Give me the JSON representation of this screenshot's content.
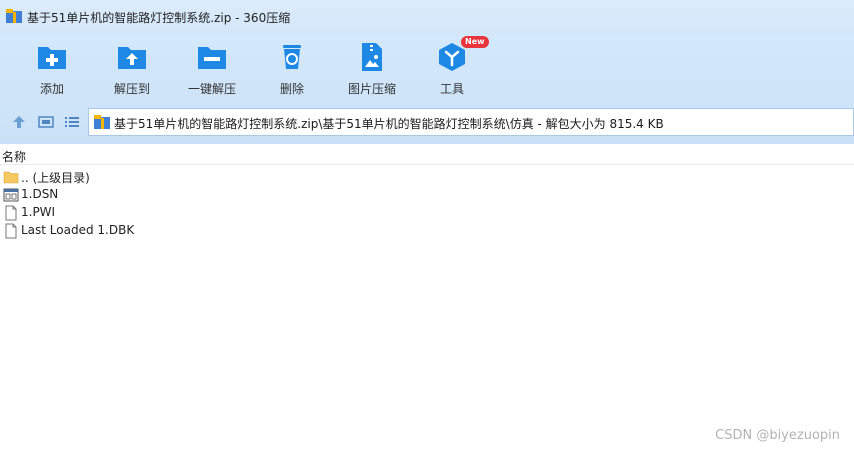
{
  "window": {
    "title": "基于51单片机的智能路灯控制系统.zip - 360压缩"
  },
  "toolbar": {
    "items": [
      {
        "label": "添加"
      },
      {
        "label": "解压到"
      },
      {
        "label": "一键解压"
      },
      {
        "label": "删除"
      },
      {
        "label": "图片压缩"
      },
      {
        "label": "工具",
        "badge": "New"
      }
    ]
  },
  "address": {
    "path": "基于51单片机的智能路灯控制系统.zip\\基于51单片机的智能路灯控制系统\\仿真 - 解包大小为 815.4 KB"
  },
  "list": {
    "header": "名称",
    "files": [
      {
        "name": ".. (上级目录)",
        "icon": "folder-icon"
      },
      {
        "name": "1.DSN",
        "icon": "dsn-file-icon"
      },
      {
        "name": "1.PWI",
        "icon": "file-icon"
      },
      {
        "name": "Last Loaded 1.DBK",
        "icon": "file-icon"
      }
    ]
  },
  "watermark": "CSDN @biyezuopin",
  "colors": {
    "accent": "#1e88e5",
    "toolbar_bg": "#d4e8fb",
    "badge": "#e8343a"
  }
}
